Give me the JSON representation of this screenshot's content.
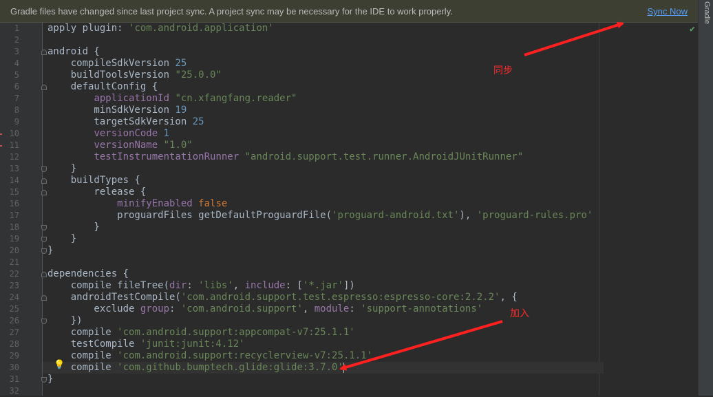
{
  "banner": {
    "message": "Gradle files have changed since last project sync. A project sync may be necessary for the IDE to work properly.",
    "sync_label": "Sync Now"
  },
  "tool_window": {
    "gradle_label": "Gradle"
  },
  "colors": {
    "keyword": "#cc7832",
    "string": "#6a8759",
    "number": "#6897bb",
    "property": "#9876aa",
    "annotation": "#ff2a2a",
    "link": "#589df6"
  },
  "annotations": {
    "sync_note": "同步",
    "add_note": "加入"
  },
  "icons": {
    "inspection_ok": "check-icon",
    "intention": "lightbulb-icon"
  },
  "editor": {
    "current_line": 30,
    "lines": [
      "1",
      "2",
      "3",
      "4",
      "5",
      "6",
      "7",
      "8",
      "9",
      "10",
      "11",
      "12",
      "13",
      "14",
      "15",
      "16",
      "17",
      "18",
      "19",
      "20",
      "21",
      "22",
      "23",
      "24",
      "25",
      "26",
      "27",
      "28",
      "29",
      "30",
      "31",
      "32"
    ],
    "code": [
      [
        {
          "t": "apply plugin: ",
          "c": ""
        },
        {
          "t": "'com.android.application'",
          "c": "s"
        }
      ],
      [],
      [
        {
          "t": "android {",
          "c": ""
        }
      ],
      [
        {
          "t": "    compileSdkVersion ",
          "c": ""
        },
        {
          "t": "25",
          "c": "n"
        }
      ],
      [
        {
          "t": "    buildToolsVersion ",
          "c": ""
        },
        {
          "t": "\"25.0.0\"",
          "c": "s"
        }
      ],
      [
        {
          "t": "    defaultConfig {",
          "c": ""
        }
      ],
      [
        {
          "t": "        ",
          "c": ""
        },
        {
          "t": "applicationId",
          "c": "p"
        },
        {
          "t": " ",
          "c": ""
        },
        {
          "t": "\"cn.xfangfang.reader\"",
          "c": "s"
        }
      ],
      [
        {
          "t": "        minSdkVersion ",
          "c": ""
        },
        {
          "t": "19",
          "c": "n"
        }
      ],
      [
        {
          "t": "        targetSdkVersion ",
          "c": ""
        },
        {
          "t": "25",
          "c": "n"
        }
      ],
      [
        {
          "t": "        ",
          "c": ""
        },
        {
          "t": "versionCode",
          "c": "p"
        },
        {
          "t": " ",
          "c": ""
        },
        {
          "t": "1",
          "c": "n"
        }
      ],
      [
        {
          "t": "        ",
          "c": ""
        },
        {
          "t": "versionName",
          "c": "p"
        },
        {
          "t": " ",
          "c": ""
        },
        {
          "t": "\"1.0\"",
          "c": "s"
        }
      ],
      [
        {
          "t": "        ",
          "c": ""
        },
        {
          "t": "testInstrumentationRunner",
          "c": "p"
        },
        {
          "t": " ",
          "c": ""
        },
        {
          "t": "\"android.support.test.runner.AndroidJUnitRunner\"",
          "c": "s"
        }
      ],
      [
        {
          "t": "    }",
          "c": ""
        }
      ],
      [
        {
          "t": "    buildTypes {",
          "c": ""
        }
      ],
      [
        {
          "t": "        release {",
          "c": ""
        }
      ],
      [
        {
          "t": "            ",
          "c": ""
        },
        {
          "t": "minifyEnabled",
          "c": "p"
        },
        {
          "t": " ",
          "c": ""
        },
        {
          "t": "false",
          "c": "k"
        }
      ],
      [
        {
          "t": "            proguardFiles getDefaultProguardFile(",
          "c": ""
        },
        {
          "t": "'proguard-android.txt'",
          "c": "s"
        },
        {
          "t": "), ",
          "c": ""
        },
        {
          "t": "'proguard-rules.pro'",
          "c": "s"
        }
      ],
      [
        {
          "t": "        }",
          "c": ""
        }
      ],
      [
        {
          "t": "    }",
          "c": ""
        }
      ],
      [
        {
          "t": "}",
          "c": ""
        }
      ],
      [],
      [
        {
          "t": "dependencies {",
          "c": ""
        }
      ],
      [
        {
          "t": "    compile fileTree(",
          "c": ""
        },
        {
          "t": "dir",
          "c": "p"
        },
        {
          "t": ": ",
          "c": ""
        },
        {
          "t": "'libs'",
          "c": "s"
        },
        {
          "t": ", ",
          "c": ""
        },
        {
          "t": "include",
          "c": "p"
        },
        {
          "t": ": [",
          "c": ""
        },
        {
          "t": "'*.jar'",
          "c": "s"
        },
        {
          "t": "])",
          "c": ""
        }
      ],
      [
        {
          "t": "    androidTestCompile(",
          "c": ""
        },
        {
          "t": "'com.android.support.test.espresso:espresso-core:2.2.2'",
          "c": "s"
        },
        {
          "t": ", {",
          "c": ""
        }
      ],
      [
        {
          "t": "        exclude ",
          "c": ""
        },
        {
          "t": "group",
          "c": "p"
        },
        {
          "t": ": ",
          "c": ""
        },
        {
          "t": "'com.android.support'",
          "c": "s"
        },
        {
          "t": ", ",
          "c": ""
        },
        {
          "t": "module",
          "c": "p"
        },
        {
          "t": ": ",
          "c": ""
        },
        {
          "t": "'support-annotations'",
          "c": "s"
        }
      ],
      [
        {
          "t": "    })",
          "c": ""
        }
      ],
      [
        {
          "t": "    compile ",
          "c": ""
        },
        {
          "t": "'com.android.support:appcompat-v7:25.1.1'",
          "c": "s"
        }
      ],
      [
        {
          "t": "    testCompile ",
          "c": ""
        },
        {
          "t": "'junit:junit:4.12'",
          "c": "s"
        }
      ],
      [
        {
          "t": "    compile ",
          "c": ""
        },
        {
          "t": "'com.android.support:recyclerview-v7:25.1.1'",
          "c": "s"
        }
      ],
      [
        {
          "t": "    compile ",
          "c": ""
        },
        {
          "t": "'com.github.bumptech.glide:glide:3.7.0'",
          "c": "s"
        }
      ],
      [
        {
          "t": "}",
          "c": ""
        }
      ],
      []
    ]
  }
}
